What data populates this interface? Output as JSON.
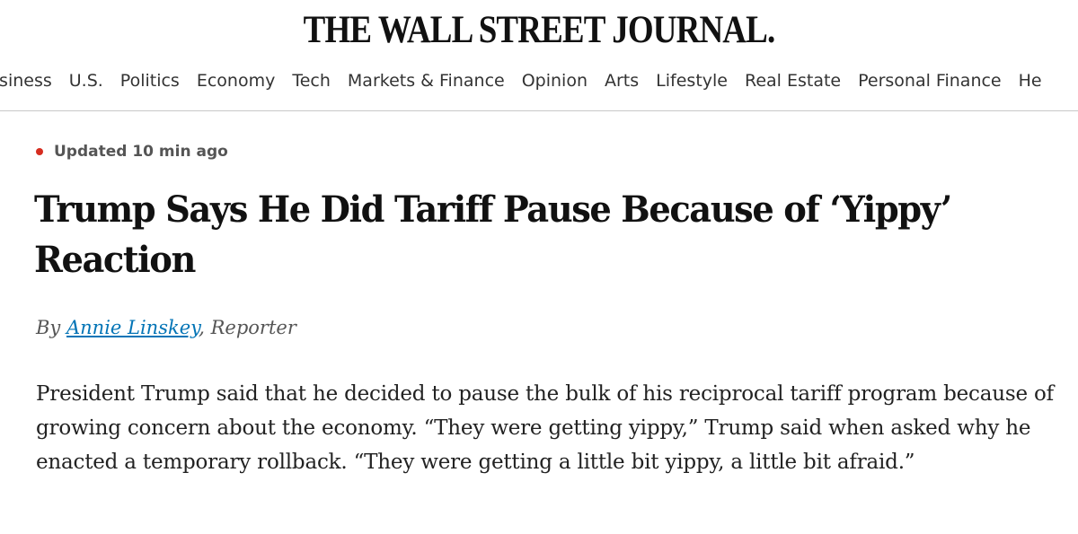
{
  "masthead": {
    "title": "THE WALL STREET JOURNAL."
  },
  "nav": {
    "items": [
      "usiness",
      "U.S.",
      "Politics",
      "Economy",
      "Tech",
      "Markets & Finance",
      "Opinion",
      "Arts",
      "Lifestyle",
      "Real Estate",
      "Personal Finance",
      "He"
    ]
  },
  "article": {
    "status": "Updated 10 min ago",
    "status_color": "#d62d20",
    "headline": "Trump Says He Did Tariff Pause Because of ‘Yippy’ Reaction",
    "byline": {
      "prefix": "By",
      "author": "Annie Linskey",
      "separator": ",",
      "role": "Reporter",
      "link_color": "#0274b6"
    },
    "body": "President Trump said that he decided to pause the bulk of his reciprocal tariff program because of growing concern about the economy. “They were getting yippy,” Trump said when asked why he enacted a temporary rollback. “They were getting a little bit yippy, a little bit afraid.”"
  }
}
